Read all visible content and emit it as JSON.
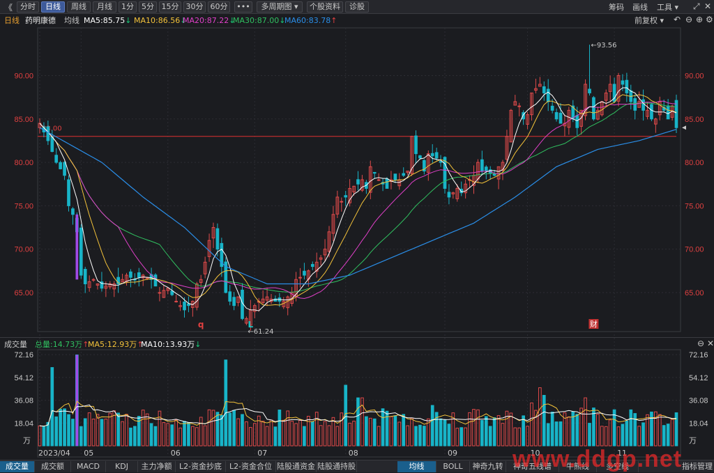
{
  "toolbar": {
    "back": "《",
    "periods": [
      "分时",
      "日线",
      "周线",
      "月线",
      "1分",
      "5分",
      "15分",
      "30分",
      "60分",
      "•••",
      "多周期图 ▾",
      "个股资料",
      "诊股"
    ],
    "active_index": 1,
    "right": [
      "筹码",
      "画线",
      "工具 ▾"
    ]
  },
  "info": {
    "period": "日线",
    "name": "药明康德",
    "ma_label": "均线",
    "ma5": "MA5:85.75",
    "ma5_arrow": "↓",
    "ma10": "MA10:86.56",
    "ma10_arrow": "↓",
    "ma20": "MA20:87.22",
    "ma20_arrow": "↓",
    "ma30": "MA30:87.00",
    "ma30_arrow": "↓",
    "ma60": "MA60:83.78",
    "ma60_arrow": "↑",
    "adjust": "前复权"
  },
  "vol_info": {
    "title": "成交量",
    "total": "总量:14.73万",
    "total_arrow": "↑",
    "ma5": "MA5:12.93万",
    "ma5_arrow": "↑",
    "ma10": "MA10:13.93万",
    "ma10_arrow": "↓"
  },
  "bottom_tabs": [
    "成交量",
    "成交额",
    "MACD",
    "KDJ",
    "主力净额",
    "L2-资金抄底",
    "L2-资金合位",
    "陆股通资金",
    "陆股通持股"
  ],
  "bottom_right_tabs": [
    "均线",
    "BOLL",
    "神奇九转",
    "神奇五线谱",
    "牛熊线",
    "多空线"
  ],
  "bottom_far_right": "指标管理",
  "watermark": "www.ddgp.net",
  "colors": {
    "up": "#e04a4a",
    "down": "#18b4c8",
    "ma5": "#ffffff",
    "ma10": "#f3c23a",
    "ma20": "#e040c8",
    "ma30": "#30c060",
    "ma60": "#2a8ee8",
    "grid": "#2c2d33",
    "hline": "#e03030",
    "axis": "#e04040",
    "vol_purple": "#a04ae8"
  },
  "chart_data": {
    "type": "candlestick",
    "y_axis_ticks": [
      "90.00",
      "85.00",
      "80.00",
      "75.00",
      "70.00",
      "65.00"
    ],
    "y_axis_values": [
      90,
      85,
      80,
      75,
      70,
      65
    ],
    "ylim": [
      60.5,
      95.5
    ],
    "x_labels": [
      "2023/04",
      "05",
      "06",
      "07",
      "08",
      "09",
      "10",
      "11"
    ],
    "x_label_positions": [
      0,
      10,
      31,
      52,
      74,
      98,
      118,
      139
    ],
    "n": 155,
    "horizontal_line": {
      "value": 83.0,
      "label": "83.00"
    },
    "annotations": [
      {
        "label": "←93.56",
        "value": 93.56,
        "index": 133
      },
      {
        "label": "←61.24",
        "value": 61.24,
        "index": 50
      }
    ],
    "event_markers": [
      {
        "label": "q",
        "index": 39
      },
      {
        "label": "L",
        "index": 51
      },
      {
        "label": "财",
        "index": 134
      }
    ],
    "volume_axis_ticks": [
      "72.16",
      "54.12",
      "36.08",
      "18.04"
    ],
    "volume_axis_values": [
      72.16,
      54.12,
      36.08,
      18.04
    ],
    "volume_unit": "万",
    "volume_ylim": [
      0,
      75
    ],
    "key_closes": [
      [
        0,
        84.5
      ],
      [
        2,
        82.5
      ],
      [
        4,
        80
      ],
      [
        6,
        78.5
      ],
      [
        7,
        75
      ],
      [
        8,
        74
      ],
      [
        9,
        72
      ],
      [
        10,
        67
      ],
      [
        11,
        66
      ],
      [
        13,
        66.5
      ],
      [
        15,
        65.5
      ],
      [
        17,
        66
      ],
      [
        19,
        66
      ],
      [
        21,
        67
      ],
      [
        23,
        66.5
      ],
      [
        25,
        67
      ],
      [
        27,
        66.5
      ],
      [
        29,
        65
      ],
      [
        31,
        65.5
      ],
      [
        33,
        64
      ],
      [
        35,
        63
      ],
      [
        37,
        64
      ],
      [
        38,
        66
      ],
      [
        39,
        66.5
      ],
      [
        40,
        68.5
      ],
      [
        41,
        71
      ],
      [
        42,
        72.5
      ],
      [
        43,
        70
      ],
      [
        44,
        68
      ],
      [
        45,
        65
      ],
      [
        46,
        64
      ],
      [
        47,
        63.5
      ],
      [
        48,
        64.5
      ],
      [
        49,
        62
      ],
      [
        50,
        62
      ],
      [
        51,
        63
      ],
      [
        53,
        64
      ],
      [
        55,
        64.5
      ],
      [
        57,
        64
      ],
      [
        59,
        64
      ],
      [
        61,
        65
      ],
      [
        62,
        66.5
      ],
      [
        64,
        67
      ],
      [
        66,
        68
      ],
      [
        68,
        69
      ],
      [
        69,
        70
      ],
      [
        70,
        72
      ],
      [
        71,
        74
      ],
      [
        72,
        76
      ],
      [
        73,
        75.5
      ],
      [
        74,
        76
      ],
      [
        75,
        77
      ],
      [
        77,
        77.5
      ],
      [
        78,
        78
      ],
      [
        79,
        77
      ],
      [
        80,
        79.5
      ],
      [
        82,
        78
      ],
      [
        84,
        77
      ],
      [
        85,
        78
      ],
      [
        87,
        78
      ],
      [
        89,
        79
      ],
      [
        90,
        83
      ],
      [
        91,
        81
      ],
      [
        92,
        80.5
      ],
      [
        93,
        79
      ],
      [
        94,
        81
      ],
      [
        96,
        80.5
      ],
      [
        97,
        80
      ],
      [
        98,
        77
      ],
      [
        99,
        76
      ],
      [
        100,
        76.5
      ],
      [
        101,
        77
      ],
      [
        102,
        76.5
      ],
      [
        103,
        77.5
      ],
      [
        105,
        78.5
      ],
      [
        106,
        80
      ],
      [
        107,
        79
      ],
      [
        108,
        79
      ],
      [
        110,
        78.5
      ],
      [
        111,
        79.5
      ],
      [
        112,
        80
      ],
      [
        113,
        83
      ],
      [
        114,
        86
      ],
      [
        115,
        87
      ],
      [
        116,
        86.5
      ],
      [
        117,
        85
      ],
      [
        118,
        85.5
      ],
      [
        119,
        88
      ],
      [
        121,
        89
      ],
      [
        122,
        88
      ],
      [
        123,
        87
      ],
      [
        124,
        86
      ],
      [
        125,
        85
      ],
      [
        126,
        84.5
      ],
      [
        127,
        84.5
      ],
      [
        128,
        86
      ],
      [
        129,
        85
      ],
      [
        130,
        84
      ],
      [
        131,
        86
      ],
      [
        132,
        89
      ],
      [
        133,
        88
      ],
      [
        134,
        85
      ],
      [
        135,
        86
      ],
      [
        136,
        87
      ],
      [
        137,
        88
      ],
      [
        138,
        89
      ],
      [
        139,
        87
      ],
      [
        140,
        90
      ],
      [
        141,
        89
      ],
      [
        142,
        88
      ],
      [
        143,
        87
      ],
      [
        144,
        86
      ],
      [
        145,
        87
      ],
      [
        146,
        86
      ],
      [
        147,
        86
      ],
      [
        148,
        85
      ],
      [
        149,
        85
      ],
      [
        150,
        87
      ],
      [
        151,
        86
      ],
      [
        152,
        85
      ],
      [
        153,
        86.5
      ],
      [
        154,
        84
      ]
    ],
    "ma60_points": [
      [
        0,
        84
      ],
      [
        15,
        80
      ],
      [
        25,
        76
      ],
      [
        35,
        72.5
      ],
      [
        45,
        68
      ],
      [
        55,
        66
      ],
      [
        65,
        66
      ],
      [
        75,
        67
      ],
      [
        85,
        69
      ],
      [
        95,
        71
      ],
      [
        105,
        73
      ],
      [
        115,
        76
      ],
      [
        125,
        79.5
      ],
      [
        135,
        81.5
      ],
      [
        145,
        82.5
      ],
      [
        154,
        83.8
      ]
    ]
  }
}
